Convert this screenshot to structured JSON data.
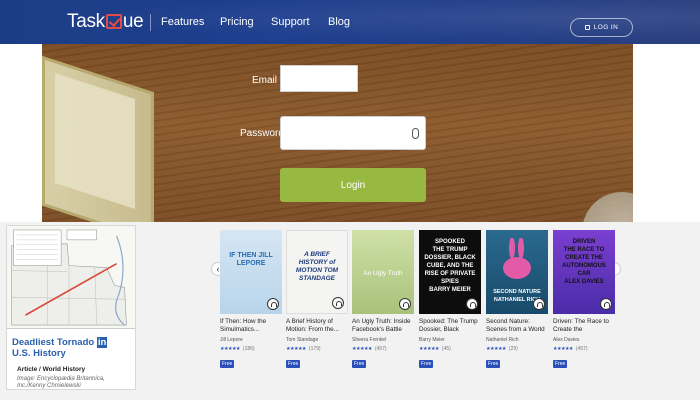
{
  "nav": {
    "logo_left": "Task",
    "logo_right": "ue",
    "links": [
      "Features",
      "Pricing",
      "Support",
      "Blog"
    ],
    "login_label": "LOG IN"
  },
  "login_form": {
    "email_label": "Email",
    "email_value": "",
    "password_label": "Password",
    "password_value": "",
    "submit_label": "Login"
  },
  "feature_card": {
    "title_main": "Deadliest Tornado ",
    "title_highlight": "in",
    "title_line2": "U.S. History",
    "category": "Article / World History",
    "credit": "Image: Encyclopædia Britannica, Inc./Kenny Chmielewski"
  },
  "carousel": {
    "prev_icon": "chevron-left-icon",
    "next_icon": "chevron-right-icon",
    "books": [
      {
        "cover_text": "IF THEN\nJILL LEPORE",
        "title": "If Then: How the Simulmatics...",
        "author": "Jill Lepore",
        "stars": "★★★★★",
        "count": "(186)",
        "badge": "Free"
      },
      {
        "cover_text": "A BRIEF HISTORY of MOTION\nTOM STANDAGE",
        "title": "A Brief History of Motion: From the...",
        "author": "Tom Standage",
        "stars": "★★★★★",
        "count": "(179)",
        "badge": "Free"
      },
      {
        "cover_text": "An Ugly Truth",
        "title": "An Ugly Truth: Inside Facebook's Battle for...",
        "author": "Sheera Frenkel",
        "stars": "★★★★★",
        "count": "(457)",
        "badge": "Free"
      },
      {
        "cover_text": "SPOOKED\nTHE TRUMP DOSSIER, BLACK CUBE, AND THE RISE OF PRIVATE SPIES\nBARRY MEIER",
        "title": "Spooked: The Trump Dossier, Black Cube,...",
        "author": "Barry Meier",
        "stars": "★★★★★",
        "count": "(45)",
        "badge": "Free"
      },
      {
        "cover_text": "SECOND NATURE\nNATHANIEL RICH",
        "title": "Second Nature: Scenes from a World Remade",
        "author": "Nathaniel Rich",
        "stars": "★★★★★",
        "count": "(29)",
        "badge": "Free"
      },
      {
        "cover_text": "DRIVEN\nTHE RACE TO CREATE THE AUTONOMOUS CAR\nALEX DAVIES",
        "title": "Driven: The Race to Create the Autonomo...",
        "author": "Alex Davies",
        "stars": "★★★★★",
        "count": "(457)",
        "badge": "Free"
      }
    ]
  },
  "colors": {
    "nav_bg": "#1f3f8f",
    "accent_green": "#98b941",
    "link_blue": "#2a5fae",
    "badge_blue": "#2a4fb8",
    "logo_red": "#e14b4b"
  }
}
